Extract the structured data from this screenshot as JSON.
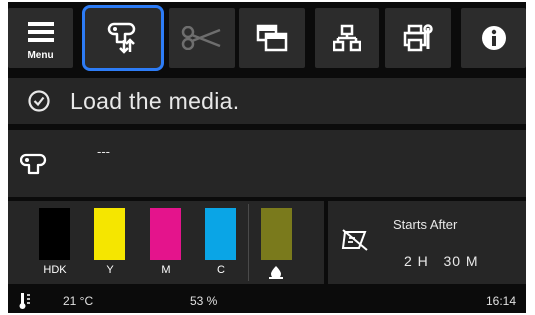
{
  "toolbar": {
    "menu_label": "Menu",
    "buttons": [
      {
        "name": "menu",
        "icon": "menu-icon"
      },
      {
        "name": "media-feed",
        "icon": "paper-feed-icon",
        "selected": true
      },
      {
        "name": "cutter",
        "icon": "scissors-icon",
        "disabled": true
      },
      {
        "name": "job-queue",
        "icon": "stacked-windows-icon"
      },
      {
        "name": "network",
        "icon": "network-icon"
      },
      {
        "name": "maintenance",
        "icon": "printer-wrench-icon"
      },
      {
        "name": "info",
        "icon": "info-icon"
      }
    ]
  },
  "message": {
    "icon": "check-circle-icon",
    "text": "Load the media."
  },
  "media": {
    "icon": "media-roll-icon",
    "value": "---"
  },
  "inks": [
    {
      "label": "HDK",
      "color": "#000000",
      "level": 1.0
    },
    {
      "label": "Y",
      "color": "#f5e600",
      "level": 1.0
    },
    {
      "label": "M",
      "color": "#e4148c",
      "level": 1.0
    },
    {
      "label": "C",
      "color": "#0aa5e6",
      "level": 1.0
    },
    {
      "label": "",
      "color": "#7a7a1c",
      "level": 1.0,
      "icon": "waste-ink-drop-icon"
    }
  ],
  "maintenance": {
    "icon": "cleaning-disabled-icon",
    "starts_label": "Starts After",
    "time": "2 H   30 M"
  },
  "status": {
    "temperature": "21 °C",
    "humidity": "53 %",
    "clock": "16:14"
  },
  "colors": {
    "accent": "#2d7cf6",
    "panel": "#262626",
    "background": "#0b0b0b"
  }
}
